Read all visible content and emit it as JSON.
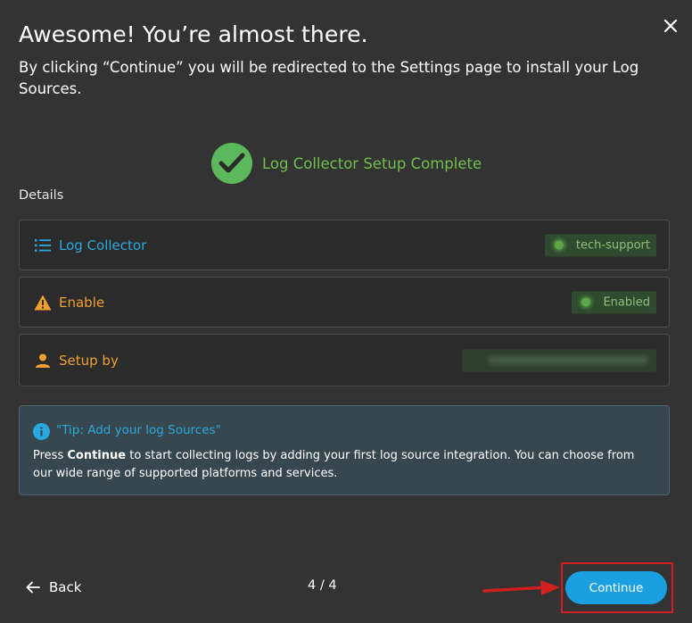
{
  "dialog": {
    "title": "Awesome! You’re almost there.",
    "subtitle": "By clicking “Continue” you will be redirected to the Settings page to install your Log Sources."
  },
  "status": {
    "text": "Log Collector Setup Complete",
    "icon": "check-circle-icon",
    "color": "#6fbf4a"
  },
  "details": {
    "label": "Details",
    "rows": [
      {
        "label": "Log Collector",
        "icon": "list-icon",
        "color": "#29a8e0",
        "value": "tech-support"
      },
      {
        "label": "Enable",
        "icon": "warning-icon",
        "color": "#f0a030",
        "value": "Enabled"
      },
      {
        "label": "Setup by",
        "icon": "person-icon",
        "color": "#f0a030",
        "value": ""
      }
    ]
  },
  "tip": {
    "title": "\"Tip: Add your log Sources\"",
    "body_pre": "Press ",
    "body_bold": "Continue",
    "body_post": " to start collecting logs by adding your first log source integration. You can choose from our wide range of supported platforms and services."
  },
  "footer": {
    "back_label": "Back",
    "step": "4 / 4",
    "continue_label": "Continue"
  },
  "colors": {
    "accent": "#1a9fe0",
    "highlight": "#d11f1f"
  }
}
